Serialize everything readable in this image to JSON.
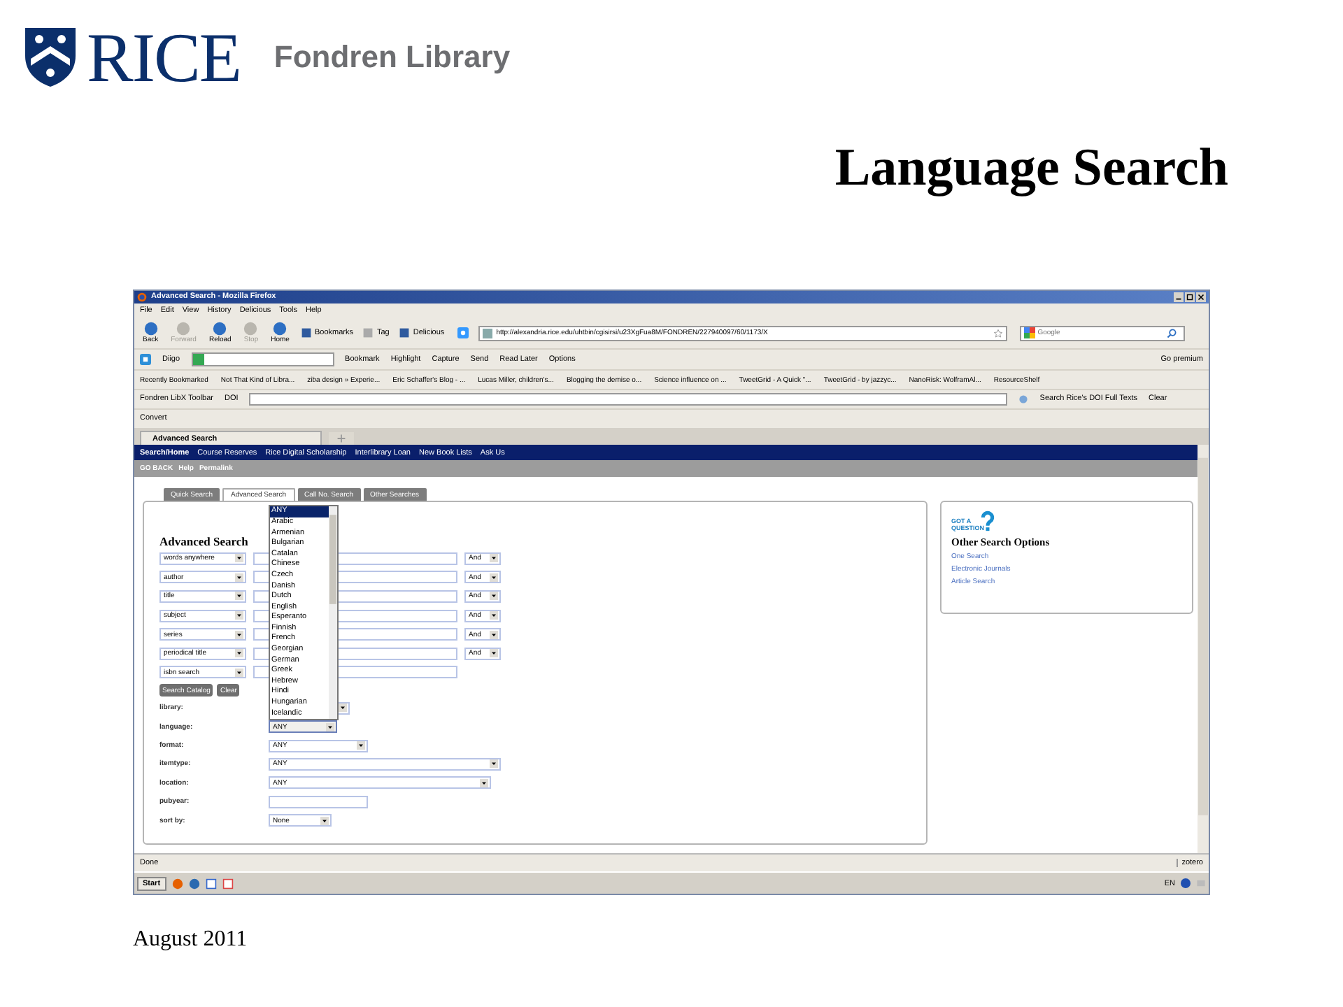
{
  "logo": {
    "wordmark": "RICE",
    "subtitle": "Fondren Library"
  },
  "slide_title": "Language Search",
  "browser": {
    "title": "Advanced Search - Mozilla Firefox",
    "menu": [
      "File",
      "Edit",
      "View",
      "History",
      "Delicious",
      "Tools",
      "Help"
    ],
    "nav_buttons": [
      {
        "label": "Back",
        "disabled": false
      },
      {
        "label": "Forward",
        "disabled": true
      },
      {
        "label": "Reload",
        "disabled": false
      },
      {
        "label": "Stop",
        "disabled": true
      },
      {
        "label": "Home",
        "disabled": false
      }
    ],
    "toolbar_buttons": [
      "Bookmarks",
      "Tag",
      "Delicious"
    ],
    "url": "http://alexandria.rice.edu/uhtbin/cgisirsi/u23XgFua8M/FONDREN/227940097/60/1173/X",
    "search_placeholder": "Google",
    "diigo": {
      "name": "Diigo",
      "items": [
        "Bookmark",
        "Highlight",
        "Capture",
        "Send",
        "Read Later",
        "Options"
      ],
      "premium": "Go premium"
    },
    "bookmarks": [
      "Recently Bookmarked",
      "Not That Kind of Libra...",
      "ziba design » Experie...",
      "Eric Schaffer's Blog - ...",
      "Lucas Miller, children's...",
      "Blogging the demise o...",
      "Science influence on ...",
      "TweetGrid - A Quick \"...",
      "TweetGrid - by jazzyc...",
      "NanoRisk: WolframAl...",
      "ResourceShelf"
    ],
    "libx": {
      "label": "Fondren LibX Toolbar",
      "doi": "DOI",
      "search": "Search Rice's DOI Full Texts",
      "clear": "Clear"
    },
    "convert": "Convert",
    "tab": "Advanced Search",
    "status": "Done",
    "zotero": "zotero",
    "start": "Start",
    "language_indicator": "EN"
  },
  "page": {
    "nav": [
      "Search/Home",
      "Course Reserves",
      "Rice Digital Scholarship",
      "Interlibrary Loan",
      "New Book Lists",
      "Ask Us"
    ],
    "subnav": [
      "GO BACK",
      "Help",
      "Permalink"
    ],
    "tabs": [
      {
        "label": "Quick Search",
        "selected": false
      },
      {
        "label": "Advanced Search",
        "selected": true
      },
      {
        "label": "Call No. Search",
        "selected": false
      },
      {
        "label": "Other Searches",
        "selected": false
      }
    ],
    "heading": "Advanced Search",
    "rows": [
      {
        "field": "words anywhere",
        "operator": "And"
      },
      {
        "field": "author",
        "operator": "And"
      },
      {
        "field": "title",
        "operator": "And"
      },
      {
        "field": "subject",
        "operator": "And"
      },
      {
        "field": "series",
        "operator": "And"
      },
      {
        "field": "periodical title",
        "operator": "And"
      },
      {
        "field": "isbn search"
      }
    ],
    "buttons": [
      "Search Catalog",
      "Clear"
    ],
    "filters": [
      {
        "label": "library:",
        "kind": "select"
      },
      {
        "label": "language:",
        "kind": "select",
        "value": "ANY",
        "expanded": true
      },
      {
        "label": "format:",
        "kind": "select",
        "value": "ANY"
      },
      {
        "label": "itemtype:",
        "kind": "select",
        "value": "ANY"
      },
      {
        "label": "location:",
        "kind": "select",
        "value": "ANY"
      },
      {
        "label": "pubyear:",
        "kind": "input"
      },
      {
        "label": "sort by:",
        "kind": "select",
        "value": "None"
      }
    ],
    "language_options": [
      {
        "label": "ANY",
        "selected": true
      },
      {
        "label": "Arabic",
        "selected": false
      },
      {
        "label": "Armenian",
        "selected": false
      },
      {
        "label": "Bulgarian",
        "selected": false
      },
      {
        "label": "Catalan",
        "selected": false
      },
      {
        "label": "Chinese",
        "selected": false
      },
      {
        "label": "Czech",
        "selected": false
      },
      {
        "label": "Danish",
        "selected": false
      },
      {
        "label": "Dutch",
        "selected": false
      },
      {
        "label": "English",
        "selected": false
      },
      {
        "label": "Esperanto",
        "selected": false
      },
      {
        "label": "Finnish",
        "selected": false
      },
      {
        "label": "French",
        "selected": false
      },
      {
        "label": "Georgian",
        "selected": false
      },
      {
        "label": "German",
        "selected": false
      },
      {
        "label": "Greek",
        "selected": false
      },
      {
        "label": "Hebrew",
        "selected": false
      },
      {
        "label": "Hindi",
        "selected": false
      },
      {
        "label": "Hungarian",
        "selected": false
      },
      {
        "label": "Icelandic",
        "selected": false
      }
    ],
    "side": {
      "badge_top": "GOT A",
      "badge_bottom": "QUESTION",
      "heading": "Other Search Options",
      "links": [
        "One Search",
        "Electronic Journals",
        "Article Search"
      ]
    }
  },
  "footer": "August 2011"
}
